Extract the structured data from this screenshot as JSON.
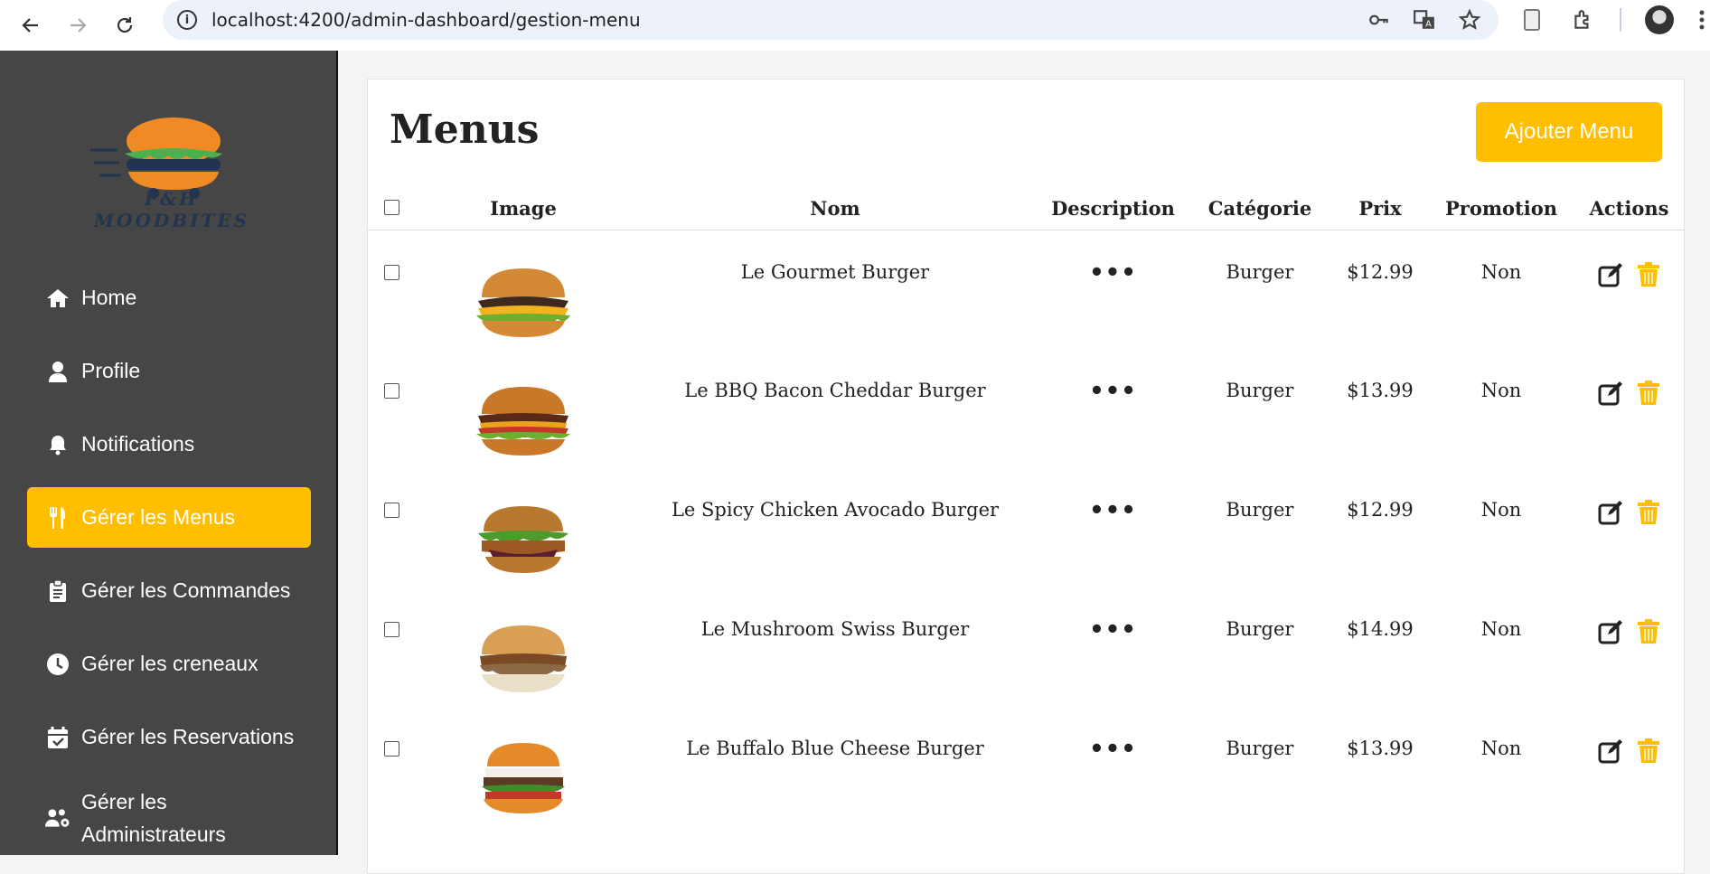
{
  "browser": {
    "url": "localhost:4200/admin-dashboard/gestion-menu"
  },
  "sidebar": {
    "logo_text": "F&H MOODBITES",
    "items": [
      {
        "label": "Home",
        "icon": "home-icon",
        "active": false
      },
      {
        "label": "Profile",
        "icon": "user-icon",
        "active": false
      },
      {
        "label": "Notifications",
        "icon": "bell-icon",
        "active": false
      },
      {
        "label": "Gérer les Menus",
        "icon": "utensils-icon",
        "active": true
      },
      {
        "label": "Gérer les Commandes",
        "icon": "clipboard-icon",
        "active": false
      },
      {
        "label": "Gérer les creneaux",
        "icon": "clock-icon",
        "active": false
      },
      {
        "label": "Gérer les Reservations",
        "icon": "calendar-check-icon",
        "active": false
      },
      {
        "label": "Gérer les Administrateurs",
        "icon": "users-gear-icon",
        "active": false
      }
    ]
  },
  "main": {
    "title": "Menus",
    "add_button": "Ajouter Menu",
    "columns": [
      "Image",
      "Nom",
      "Description",
      "Catégorie",
      "Prix",
      "Promotion",
      "Actions"
    ],
    "description_placeholder": "•••",
    "rows": [
      {
        "nom": "Le Gourmet Burger",
        "categorie": "Burger",
        "prix": "$12.99",
        "promotion": "Non"
      },
      {
        "nom": "Le BBQ Bacon Cheddar Burger",
        "categorie": "Burger",
        "prix": "$13.99",
        "promotion": "Non"
      },
      {
        "nom": "Le Spicy Chicken Avocado Burger",
        "categorie": "Burger",
        "prix": "$12.99",
        "promotion": "Non"
      },
      {
        "nom": "Le Mushroom Swiss Burger",
        "categorie": "Burger",
        "prix": "$14.99",
        "promotion": "Non"
      },
      {
        "nom": "Le Buffalo Blue Cheese Burger",
        "categorie": "Burger",
        "prix": "$13.99",
        "promotion": "Non"
      }
    ]
  },
  "colors": {
    "accent": "#ffbf00",
    "sidebar_bg": "#464646",
    "delete_icon": "#ffbf00"
  }
}
